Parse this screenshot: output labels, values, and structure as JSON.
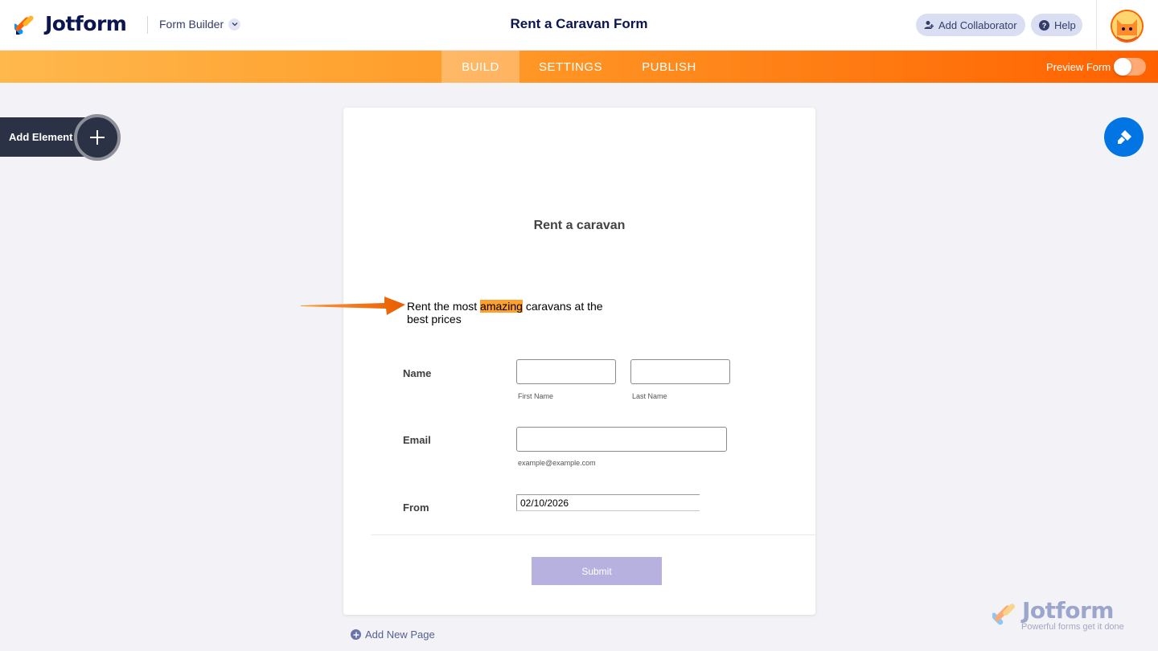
{
  "header": {
    "logo_text": "Jotform",
    "builder_menu": "Form Builder",
    "form_title": "Rent a Caravan Form",
    "add_collaborator": "Add Collaborator",
    "help": "Help"
  },
  "nav": {
    "tabs": [
      {
        "label": "BUILD",
        "active": true
      },
      {
        "label": "SETTINGS",
        "active": false
      },
      {
        "label": "PUBLISH",
        "active": false
      }
    ],
    "preview_label": "Preview Form",
    "preview_on": false
  },
  "sidebar": {
    "add_element": "Add Element"
  },
  "form": {
    "heading": "Rent a caravan",
    "description": {
      "before": "Rent the most ",
      "highlight": "amazing",
      "after": " caravans at the best prices"
    },
    "name_label": "Name",
    "first_name_sub": "First Name",
    "last_name_sub": "Last Name",
    "email_label": "Email",
    "email_sub": "example@example.com",
    "from_label": "From",
    "from_value": "02/10/2026",
    "submit": "Submit"
  },
  "footer": {
    "add_page": "Add New Page",
    "watermark_text": "Jotform",
    "watermark_tagline": "Powerful forms get it done"
  },
  "colors": {
    "brand_navy": "#0a1551",
    "orange": "#ff6100",
    "highlight": "#ff9f2e",
    "theme_blue": "#0075e3",
    "submit_bg": "#b6b1df"
  }
}
